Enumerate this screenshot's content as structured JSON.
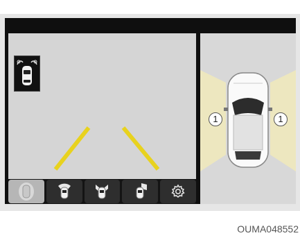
{
  "top_view": {
    "zone_left_label": "1",
    "zone_right_label": "1",
    "zone_color": "#ede7bf"
  },
  "camera": {
    "guide_line_color": "#e8d21e",
    "background_color": "#d5d5d5"
  },
  "buttons": [
    {
      "icon": "car-all-views-icon",
      "active": true
    },
    {
      "icon": "car-rear-view-icon",
      "active": false
    },
    {
      "icon": "car-rear-side-view-icon",
      "active": false
    },
    {
      "icon": "car-side-view-icon",
      "active": false
    },
    {
      "icon": "gear-icon",
      "active": false
    }
  ],
  "caption": "OUMA048552"
}
